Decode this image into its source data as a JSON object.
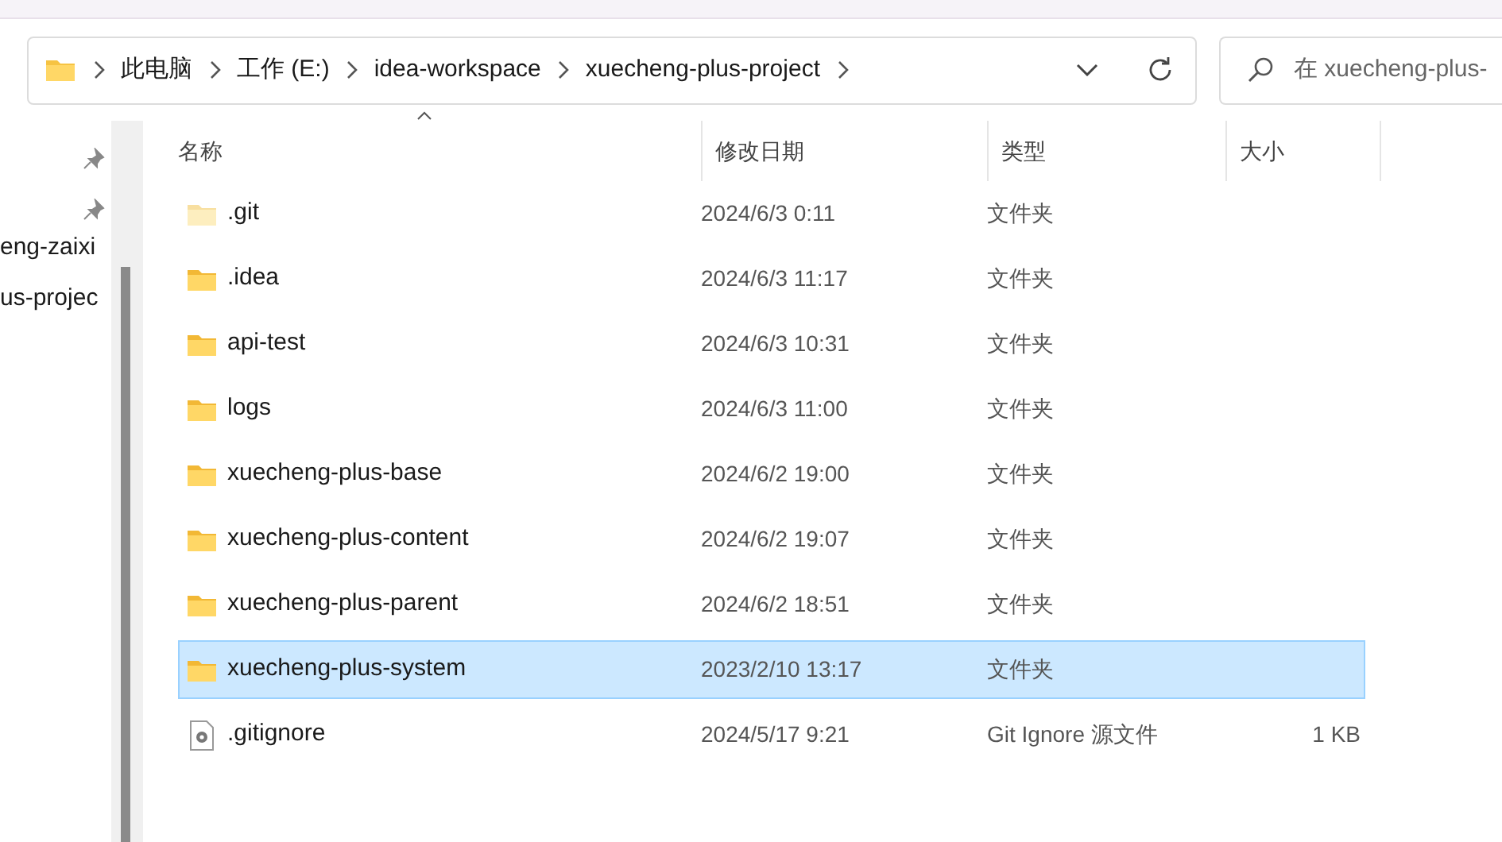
{
  "address_bar": {
    "crumbs": [
      "此电脑",
      "工作 (E:)",
      "idea-workspace",
      "xuecheng-plus-project"
    ]
  },
  "search": {
    "placeholder": "在 xuecheng-plus-"
  },
  "nav_pane": {
    "items": [
      {
        "label": "eng-zaixi",
        "pinned": true
      },
      {
        "label": "us-projec",
        "pinned": true
      }
    ]
  },
  "columns": [
    {
      "label": "名称",
      "sorted": true
    },
    {
      "label": "修改日期"
    },
    {
      "label": "类型"
    },
    {
      "label": "大小"
    }
  ],
  "rows": [
    {
      "kind": "folder",
      "hidden": true,
      "name": ".git",
      "date": "2024/6/3 0:11",
      "type": "文件夹",
      "selected": false
    },
    {
      "kind": "folder",
      "hidden": false,
      "name": ".idea",
      "date": "2024/6/3 11:17",
      "type": "文件夹",
      "selected": false
    },
    {
      "kind": "folder",
      "hidden": false,
      "name": "api-test",
      "date": "2024/6/3 10:31",
      "type": "文件夹",
      "selected": false
    },
    {
      "kind": "folder",
      "hidden": false,
      "name": "logs",
      "date": "2024/6/3 11:00",
      "type": "文件夹",
      "selected": false
    },
    {
      "kind": "folder",
      "hidden": false,
      "name": "xuecheng-plus-base",
      "date": "2024/6/2 19:00",
      "type": "文件夹",
      "selected": false
    },
    {
      "kind": "folder",
      "hidden": false,
      "name": "xuecheng-plus-content",
      "date": "2024/6/2 19:07",
      "type": "文件夹",
      "selected": false
    },
    {
      "kind": "folder",
      "hidden": false,
      "name": "xuecheng-plus-parent",
      "date": "2024/6/2 18:51",
      "type": "文件夹",
      "selected": false
    },
    {
      "kind": "folder",
      "hidden": false,
      "name": "xuecheng-plus-system",
      "date": "2023/2/10 13:17",
      "type": "文件夹",
      "selected": true
    },
    {
      "kind": "file",
      "hidden": false,
      "name": ".gitignore",
      "date": "2024/5/17 9:21",
      "type": "Git Ignore 源文件",
      "size": "1 KB",
      "selected": false
    }
  ]
}
